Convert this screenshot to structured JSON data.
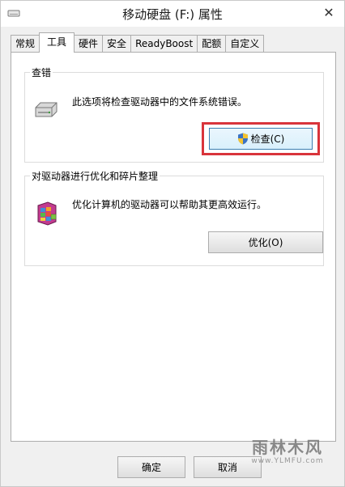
{
  "window": {
    "title": "移动硬盘 (F:) 属性",
    "close_glyph": "✕"
  },
  "tabs": [
    {
      "label": "常规",
      "active": false
    },
    {
      "label": "工具",
      "active": true
    },
    {
      "label": "硬件",
      "active": false
    },
    {
      "label": "安全",
      "active": false
    },
    {
      "label": "ReadyBoost",
      "active": false
    },
    {
      "label": "配额",
      "active": false
    },
    {
      "label": "自定义",
      "active": false
    }
  ],
  "error_check": {
    "group_label": "查错",
    "description": "此选项将检查驱动器中的文件系统错误。",
    "button_label": "检查(C)",
    "icon": "drive-icon"
  },
  "optimize": {
    "group_label": "对驱动器进行优化和碎片整理",
    "description": "优化计算机的驱动器可以帮助其更高效运行。",
    "button_label": "优化(O)",
    "icon": "defrag-icon"
  },
  "footer": {
    "ok_label": "确定",
    "cancel_label": "取消"
  },
  "watermark": {
    "text": "雨林木风",
    "url": "www.YLMFU.com"
  },
  "colors": {
    "highlight": "#d9343b",
    "focus_border": "#3c7fb1"
  }
}
